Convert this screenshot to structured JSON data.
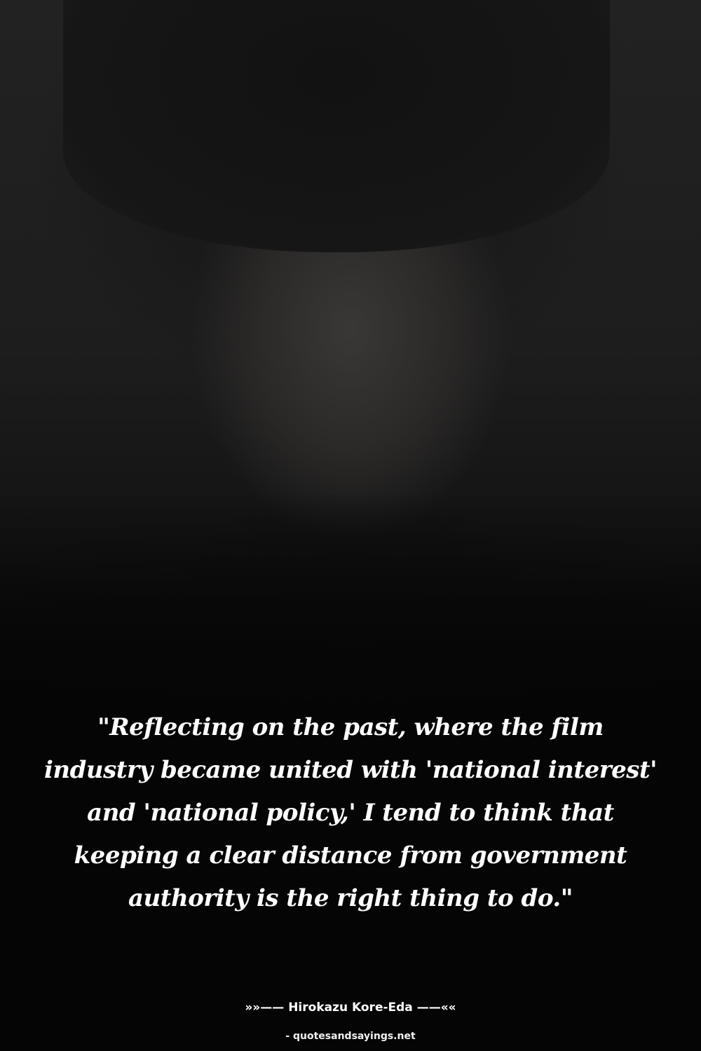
{
  "quote": {
    "text": "\"Reflecting on the past, where the film industry became united with 'national interest' and 'national policy,' I tend to think that keeping a clear distance from government authority is the right thing to do.\""
  },
  "author": {
    "line": "»»—— Hirokazu Kore-Eda ——««"
  },
  "source": {
    "label": "- quotesandsayings.net"
  },
  "colors": {
    "background": "#050505",
    "text": "#ffffff"
  }
}
